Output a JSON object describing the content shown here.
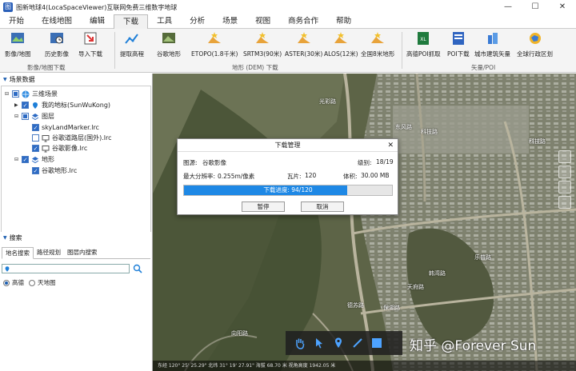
{
  "window": {
    "title": "图新地球4(LocaSpaceViewer)互联网免费三维数字地球",
    "min": "—",
    "max": "☐",
    "close": "✕"
  },
  "menu": [
    "开始",
    "在线地图",
    "编辑",
    "下载",
    "工具",
    "分析",
    "场景",
    "视图",
    "商务合作",
    "帮助"
  ],
  "active_menu": "下载",
  "ribbon": {
    "buttons": [
      {
        "label": "影像/地图",
        "icon": "image-map-icon"
      },
      {
        "label": "历史影像",
        "icon": "history-image-icon"
      },
      {
        "label": "导入下载",
        "icon": "import-download-icon"
      },
      {
        "label": "提取高程",
        "icon": "elevation-extract-icon"
      },
      {
        "label": "谷歌地形",
        "icon": "google-terrain-icon"
      },
      {
        "label": "ETOPO(1.8千米)",
        "icon": "terrain-star-icon"
      },
      {
        "label": "SRTM3(90米)",
        "icon": "terrain-star-icon"
      },
      {
        "label": "ASTER(30米)",
        "icon": "terrain-star-icon"
      },
      {
        "label": "ALOS(12米)",
        "icon": "terrain-star-icon"
      },
      {
        "label": "全国8米地形",
        "icon": "terrain-star-icon"
      },
      {
        "label": "高德POI抓取",
        "icon": "excel-poi-icon"
      },
      {
        "label": "POI下载",
        "icon": "poi-download-icon"
      },
      {
        "label": "城市建筑矢量",
        "icon": "building-vector-icon"
      },
      {
        "label": "全球行政区划",
        "icon": "admin-region-icon"
      }
    ],
    "groups": [
      "影像/地图下载",
      "地形 (DEM) 下载",
      "矢量/POI"
    ]
  },
  "scene_panel": {
    "title": "场景数据",
    "nodes": [
      "三维场景",
      "我的地标(SunWuKong)",
      "图层",
      "skyLandMarker.lrc",
      "谷歌道路层(国外).lrc",
      "谷歌影像.lrc",
      "地形",
      "谷歌地形.lrc"
    ]
  },
  "search_panel": {
    "title": "搜索",
    "tabs": [
      "地名搜索",
      "路径规划",
      "图层内搜索"
    ],
    "input_value": "",
    "options": [
      "高德",
      "天地图"
    ],
    "selected": "高德"
  },
  "dialog": {
    "title": "下载管理",
    "source_label": "图源:",
    "source_value": "谷歌影像",
    "level_label": "级别:",
    "level_value": "18/19",
    "resolution_label": "最大分辨率:",
    "resolution_value": "0.255m/像素",
    "tiles_label": "瓦片:",
    "tiles_value": "120",
    "size_label": "体积:",
    "size_value": "30.00 MB",
    "progress_text": "下载进度: 94/120",
    "progress_fraction": 0.783,
    "pause": "暂停",
    "cancel": "取消"
  },
  "map": {
    "labels": [
      "光彩路",
      "科技路",
      "东风路",
      "科技路",
      "乐普路",
      "韩湾路",
      "天府路",
      "保湖路",
      "向阳路",
      "德苏路"
    ],
    "status": "东经 120° 25' 25.29\" 北纬 31° 19' 27.91\"   海拔 68.70 米  视角高度 1942.05 米",
    "watermark": "知乎 @Forever Sun"
  }
}
